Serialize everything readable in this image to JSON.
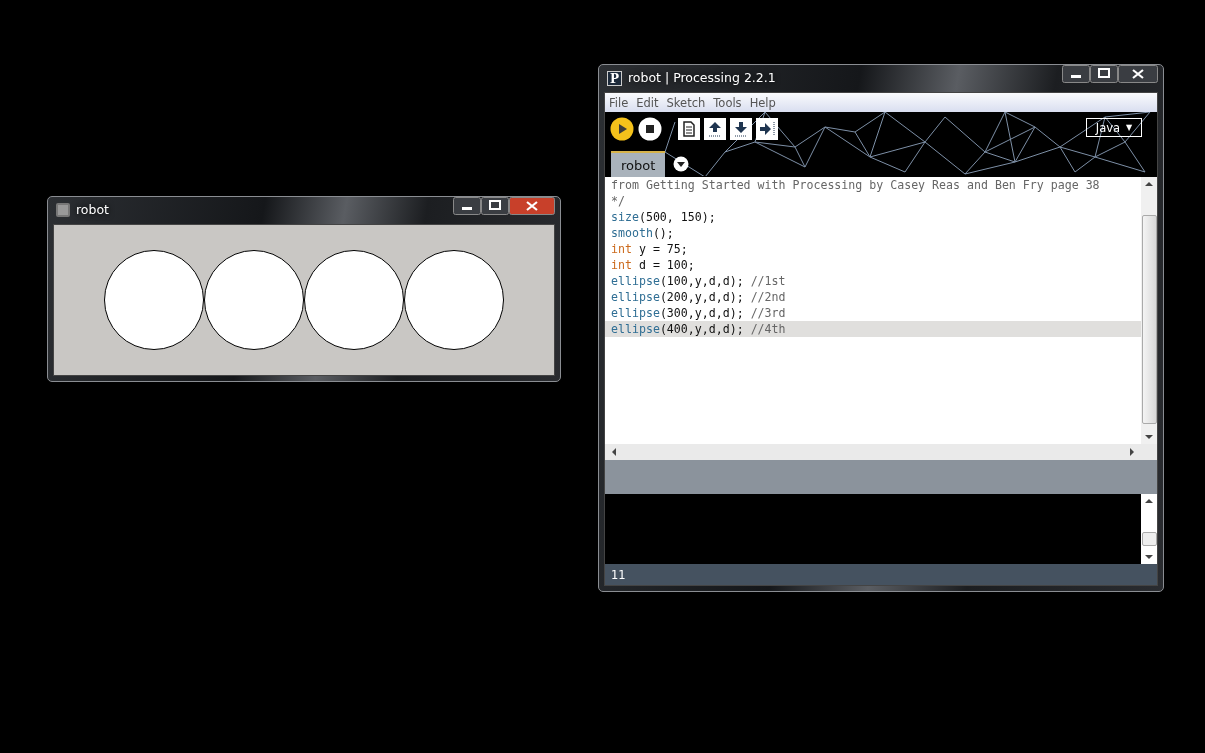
{
  "sketch_window": {
    "title": "robot"
  },
  "editor_window": {
    "app_icon": "P",
    "title": "robot | Processing 2.2.1",
    "menu": [
      "File",
      "Edit",
      "Sketch",
      "Tools",
      "Help"
    ],
    "mode": "Java",
    "mode_caret": "▼",
    "tabs": [
      {
        "label": "robot",
        "selected": true
      }
    ],
    "code_lines": [
      {
        "highlighted": false,
        "tokens": [
          {
            "kind": "comment",
            "text": "from Getting Started with Processing by Casey Reas and Ben Fry page 38"
          }
        ]
      },
      {
        "highlighted": false,
        "tokens": [
          {
            "kind": "comment",
            "text": "*/"
          }
        ]
      },
      {
        "highlighted": false,
        "tokens": [
          {
            "kind": "function",
            "text": "size"
          },
          {
            "kind": "plain",
            "text": "(500, 150);"
          }
        ]
      },
      {
        "highlighted": false,
        "tokens": [
          {
            "kind": "function",
            "text": "smooth"
          },
          {
            "kind": "plain",
            "text": "();"
          }
        ]
      },
      {
        "highlighted": false,
        "tokens": [
          {
            "kind": "keyword",
            "text": "int"
          },
          {
            "kind": "plain",
            "text": " y = 75;"
          }
        ]
      },
      {
        "highlighted": false,
        "tokens": [
          {
            "kind": "keyword",
            "text": "int"
          },
          {
            "kind": "plain",
            "text": " d = 100;"
          }
        ]
      },
      {
        "highlighted": false,
        "tokens": [
          {
            "kind": "function",
            "text": "ellipse"
          },
          {
            "kind": "plain",
            "text": "(100,y,d,d); "
          },
          {
            "kind": "comment",
            "text": "//1st"
          }
        ]
      },
      {
        "highlighted": false,
        "tokens": [
          {
            "kind": "function",
            "text": "ellipse"
          },
          {
            "kind": "plain",
            "text": "(200,y,d,d); "
          },
          {
            "kind": "comment",
            "text": "//2nd"
          }
        ]
      },
      {
        "highlighted": false,
        "tokens": [
          {
            "kind": "function",
            "text": "ellipse"
          },
          {
            "kind": "plain",
            "text": "(300,y,d,d); "
          },
          {
            "kind": "comment",
            "text": "//3rd"
          }
        ]
      },
      {
        "highlighted": true,
        "tokens": [
          {
            "kind": "function",
            "text": "ellipse"
          },
          {
            "kind": "plain",
            "text": "(400,y,d,d); "
          },
          {
            "kind": "comment",
            "text": "//4th"
          }
        ]
      }
    ],
    "status_line": "11"
  }
}
